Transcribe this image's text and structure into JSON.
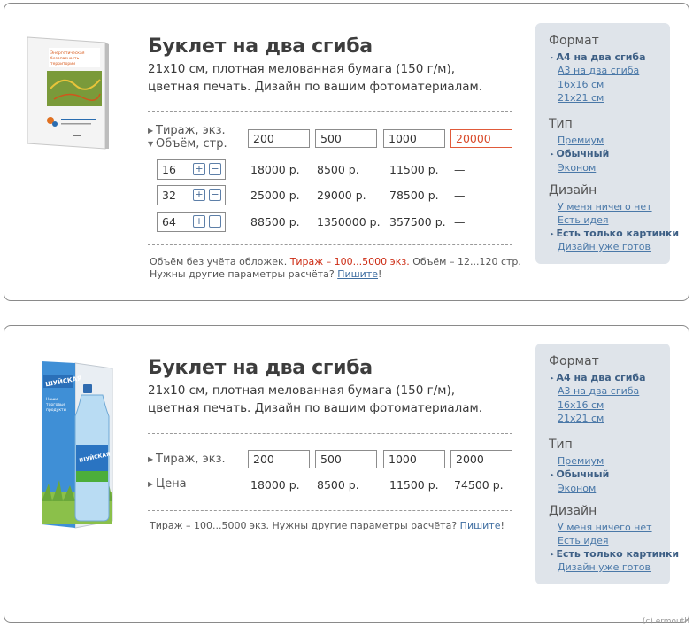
{
  "cards": [
    {
      "title": "Буклет на два сгиба",
      "desc_line1": "21х10 см, плотная мелованная бумага (150 г/м),",
      "desc_line2": "цветная печать. Дизайн по вашим фотоматериалам.",
      "label_tirazh": "Тираж, экз.",
      "label_volume": "Объём, стр.",
      "qty": [
        "200",
        "500",
        "1000",
        "20000"
      ],
      "volumes": [
        {
          "value": "16",
          "prices": [
            "18000 р.",
            "8500 р.",
            "11500 р.",
            "—"
          ]
        },
        {
          "value": "32",
          "prices": [
            "25000 р.",
            "29000 р.",
            "78500 р.",
            "—"
          ]
        },
        {
          "value": "64",
          "prices": [
            "88500 р.",
            "1350000 р.",
            "357500 р.",
            "—"
          ]
        }
      ],
      "plus": "+",
      "minus": "−",
      "note1_a": "Объём без учёта обложек.",
      "note1_red": "Тираж – 100...5000 экз.",
      "note1_b": "Объём – 12...120 стр.",
      "note2_a": "Нужны другие параметры расчёта?",
      "note2_link": "Пишите",
      "note2_end": "!",
      "book_title": "Энергетическая безопасность территории"
    },
    {
      "title": "Буклет на два сгиба",
      "desc_line1": "21х10 см, плотная мелованная бумага (150 г/м),",
      "desc_line2": "цветная печать. Дизайн по вашим фотоматериалам.",
      "label_tirazh": "Тираж, экз.",
      "label_price": "Цена",
      "qty": [
        "200",
        "500",
        "1000",
        "2000"
      ],
      "prices": [
        "18000 р.",
        "8500 р.",
        "11500 р.",
        "74500 р."
      ],
      "note_a": "Тираж – 100...5000 экз. Нужны другие параметры расчёта?",
      "note_link": "Пишите",
      "note_end": "!",
      "book_title": "Шуйская",
      "book_sub": "Наши торговые продукты"
    }
  ],
  "panel": {
    "format_title": "Формат",
    "format_options": [
      "А4 на два сгиба",
      "А3 на два сгиба",
      "16х16 см",
      "21х21 см"
    ],
    "type_title": "Тип",
    "type_options": [
      "Премиум",
      "Обычный",
      "Эконом"
    ],
    "design_title": "Дизайн",
    "design_options": [
      "У меня ничего нет",
      "Есть идея",
      "Есть только картинки",
      "Дизайн уже готов"
    ],
    "bullet": "▸"
  },
  "copyright": "(c) ermouth",
  "colors": {
    "accent_link": "#4a78a8",
    "active_border": "#e05a3a",
    "warning_text": "#cc2a12",
    "panel_bg": "#dfe4ea"
  }
}
